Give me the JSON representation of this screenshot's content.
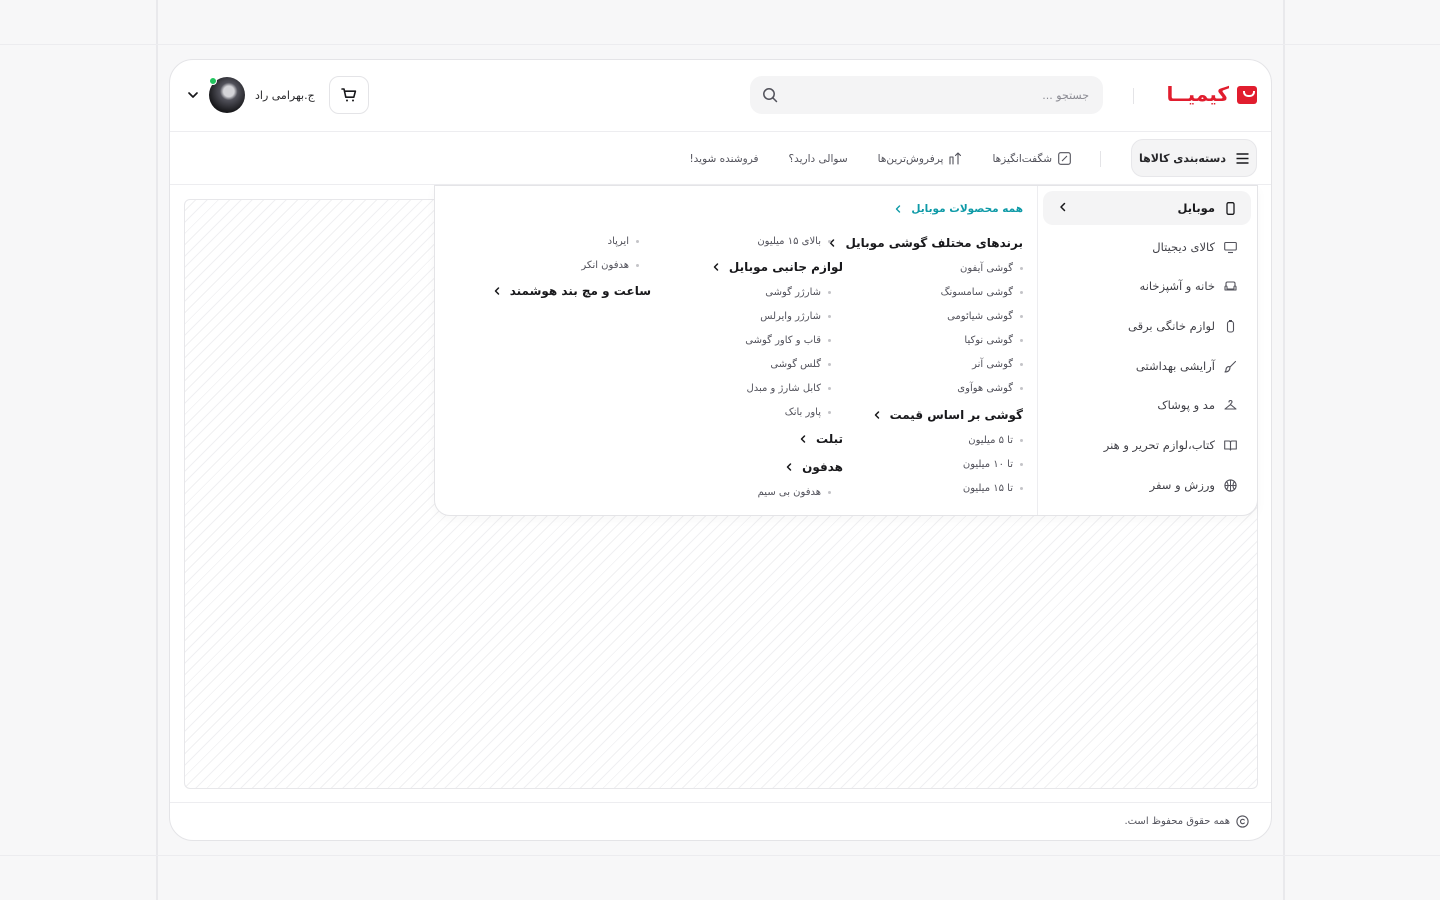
{
  "header": {
    "logo_text": "کیمیــا",
    "search_placeholder": "جستجو ...",
    "user_name": "ج.بهرامی راد"
  },
  "navbar": {
    "categories_label": "دسته‌بندی کالاها",
    "links": [
      "شگفت‌انگیزها",
      "پرفروش‌ترین‌ها",
      "سوالی دارید؟",
      "فروشنده شوید!"
    ]
  },
  "menu": {
    "categories": [
      "موبایل",
      "کالای دیجیتال",
      "خانه و آشپزخانه",
      "لوازم خانگی برقی",
      "آرایشی بهداشتی",
      "مد و پوشاک",
      "کتاب،لوازم تحریر و هنر",
      "ورزش و سفر"
    ],
    "all_products_link": "همه محصولات موبایل",
    "col1": {
      "heading1": "برندهای مختلف گوشی موبایل",
      "links1": [
        "گوشی آیفون",
        "گوشی سامسونگ",
        "گوشی شیائومی",
        "گوشی نوکیا",
        "گوشی آنر",
        "گوشی هوآوی"
      ],
      "heading2": "گوشی بر اساس قیمت",
      "links2": [
        "تا ۵ میلیون",
        "تا ۱۰ میلیون",
        "تا ۱۵ میلیون"
      ]
    },
    "col2": {
      "top_link": "بالای ۱۵ میلیون",
      "heading1": "لوازم جانبی موبایل",
      "links1": [
        "شارژر گوشی",
        "شارژر وایرلس",
        "قاب و کاور گوشی",
        "گلس گوشی",
        "کابل شارژ و مبدل",
        "پاور بانک"
      ],
      "heading2": "تبلت",
      "heading3": "هدفون",
      "links3": [
        "هدفون بی سیم"
      ]
    },
    "col3": {
      "links1": [
        "ایرپاد",
        "هدفون انکر"
      ],
      "heading1": "ساعت و مچ بند هوشمند"
    }
  },
  "footer": {
    "copyright": "همه حقوق محفوظ است."
  },
  "colors": {
    "brand": "#e11d2e",
    "accent_link": "#0e9aa7",
    "online_status": "#22c55e"
  }
}
